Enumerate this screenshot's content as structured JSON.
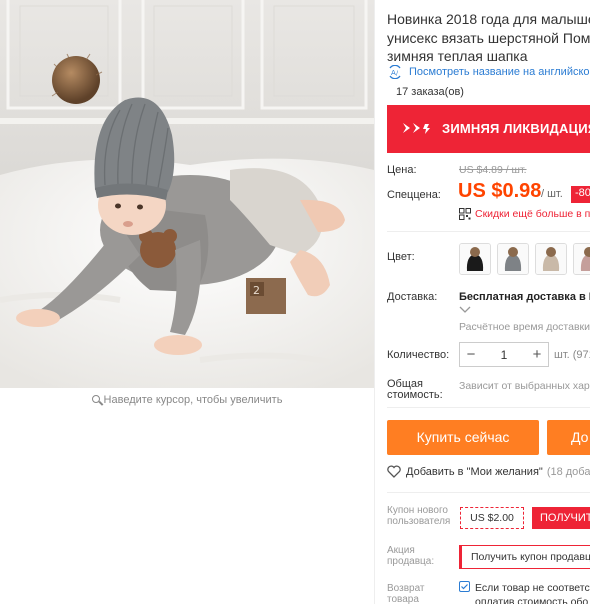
{
  "product": {
    "title_lines": [
      "Новинка 2018 года для малышей",
      "унисекс вязать шерстяной Помпо",
      "зимняя теплая шапка"
    ],
    "translate_link": "Посмотреть название на английско",
    "orders": "17 заказа(ов)"
  },
  "banner": {
    "text": "ЗИМНЯЯ ЛИКВИДАЦИЯ"
  },
  "price": {
    "label": "Цена:",
    "old": "US $4.89 / шт.",
    "special_label": "Спеццена:",
    "current": "US $0.98",
    "unit": "/ шт.",
    "discount": "-80",
    "qr_text": "Скидки ещё больше в п"
  },
  "color": {
    "label": "Цвет:",
    "swatches": [
      {
        "name": "black",
        "color": "#1a1a1a"
      },
      {
        "name": "grey",
        "color": "#7e8286"
      },
      {
        "name": "beige",
        "color": "#c9b9a8"
      },
      {
        "name": "pink",
        "color": "#c59f9b"
      }
    ]
  },
  "delivery": {
    "label": "Доставка:",
    "value": "Бесплатная доставка в Ru",
    "time": "Расчётное время доставки"
  },
  "quantity": {
    "label": "Количество:",
    "minus": "−",
    "value": "1",
    "plus": "+",
    "unit": "шт. (971"
  },
  "total": {
    "label_lines": [
      "Общая",
      "стоимость:"
    ],
    "value": "Зависит от выбранных хар"
  },
  "actions": {
    "buy": "Купить сейчас",
    "cart": "До"
  },
  "wishlist": {
    "text": "Добавить в \"Мои желания\"",
    "count": "(18 добав"
  },
  "coupon": {
    "label_lines": [
      "Купон нового",
      "пользователя"
    ],
    "value": "US $2.00",
    "get": "ПОЛУЧИТ"
  },
  "seller_promo": {
    "label_lines": [
      "Акция",
      "продавца:"
    ],
    "value": "Получить купон продавц"
  },
  "returns": {
    "label_lines": [
      "Возврат",
      "товара"
    ],
    "lines": [
      "Если товар не соответст",
      "оплатив стоимость обо"
    ]
  },
  "zoom_hint": "Наведите курсор, чтобы увеличить",
  "colors": {
    "accent": "#ff4400",
    "banner": "#ee2436",
    "button": "#ff7e22",
    "link": "#2b7cd3"
  }
}
